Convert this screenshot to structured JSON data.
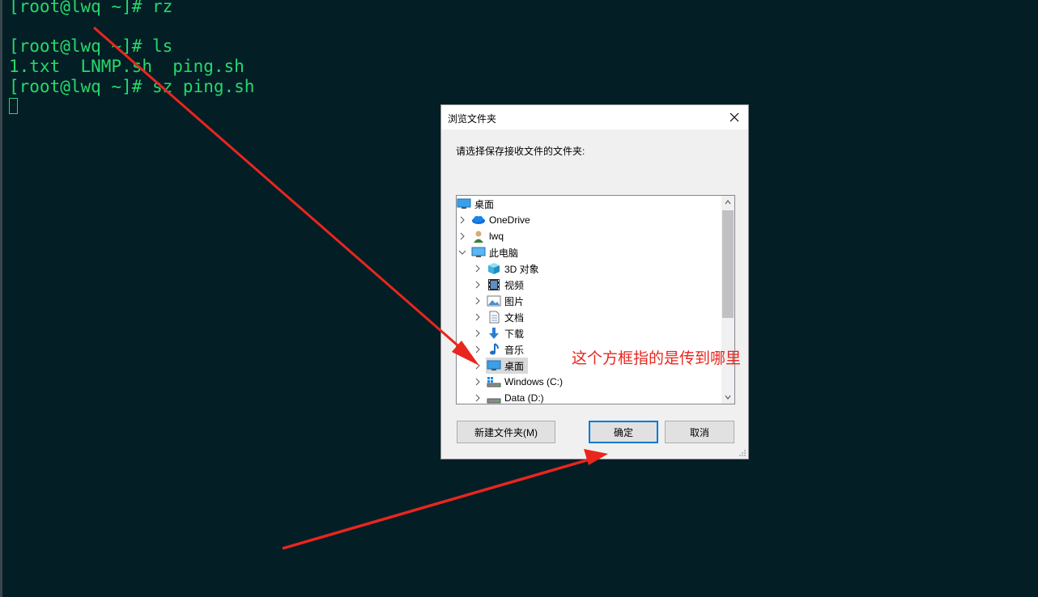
{
  "terminal": {
    "lines": [
      "[root@lwq ~]# rz",
      "",
      "[root@lwq ~]# ls",
      "1.txt  LNMP.sh  ping.sh",
      "[root@lwq ~]# sz ping.sh"
    ],
    "text_color": "#25d96a",
    "background": "#041e26"
  },
  "dialog": {
    "title": "浏览文件夹",
    "prompt": "请选择保存接收文件的文件夹:",
    "tree": [
      {
        "label": "桌面",
        "icon": "desktop-icon",
        "level": 0,
        "expander": "none"
      },
      {
        "label": "OneDrive",
        "icon": "cloud-icon",
        "level": 1,
        "expander": "collapsed"
      },
      {
        "label": "lwq",
        "icon": "user-icon",
        "level": 1,
        "expander": "collapsed"
      },
      {
        "label": "此电脑",
        "icon": "computer-icon",
        "level": 1,
        "expander": "expanded"
      },
      {
        "label": "3D 对象",
        "icon": "cube-icon",
        "level": 2,
        "expander": "collapsed"
      },
      {
        "label": "视频",
        "icon": "film-icon",
        "level": 2,
        "expander": "collapsed"
      },
      {
        "label": "图片",
        "icon": "picture-icon",
        "level": 2,
        "expander": "collapsed"
      },
      {
        "label": "文档",
        "icon": "document-icon",
        "level": 2,
        "expander": "collapsed"
      },
      {
        "label": "下载",
        "icon": "download-arrow-icon",
        "level": 2,
        "expander": "collapsed"
      },
      {
        "label": "音乐",
        "icon": "music-note-icon",
        "level": 2,
        "expander": "collapsed"
      },
      {
        "label": "桌面",
        "icon": "desktop-icon",
        "level": 2,
        "expander": "collapsed",
        "selected": true
      },
      {
        "label": "Windows (C:)",
        "icon": "windows-drive-icon",
        "level": 2,
        "expander": "collapsed"
      },
      {
        "label": "Data (D:)",
        "icon": "drive-icon",
        "level": 2,
        "expander": "collapsed"
      }
    ],
    "buttons": {
      "new_folder": "新建文件夹(M)",
      "ok": "确定",
      "cancel": "取消"
    },
    "accent_color": "#0078d7"
  },
  "annotation": {
    "text": "这个方框指的是传到哪里",
    "color": "#e8261e"
  }
}
